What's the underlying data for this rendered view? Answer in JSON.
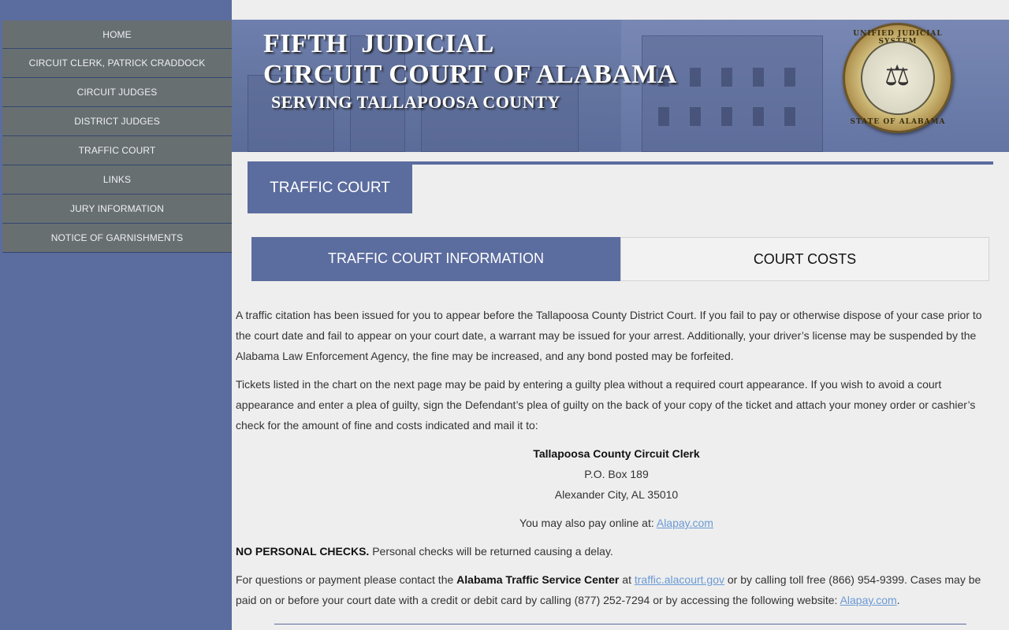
{
  "sidebar": {
    "items": [
      {
        "label": "HOME"
      },
      {
        "label": "CIRCUIT CLERK, PATRICK CRADDOCK"
      },
      {
        "label": "CIRCUIT JUDGES"
      },
      {
        "label": "DISTRICT JUDGES"
      },
      {
        "label": "TRAFFIC COURT"
      },
      {
        "label": "LINKS"
      },
      {
        "label": "JURY INFORMATION"
      },
      {
        "label": "NOTICE OF GARNISHMENTS"
      }
    ]
  },
  "banner": {
    "line1": "FIFTH  JUDICIAL",
    "line2": "CIRCUIT COURT OF ALABAMA",
    "line3": "SERVING TALLAPOOSA COUNTY",
    "seal_top": "UNIFIED JUDICIAL SYSTEM",
    "seal_bottom": "STATE OF ALABAMA",
    "seal_icon": "scales-of-justice-icon"
  },
  "section": {
    "title": "TRAFFIC COURT"
  },
  "tabs": [
    {
      "label": "TRAFFIC COURT INFORMATION",
      "active": true
    },
    {
      "label": "COURT COSTS",
      "active": false
    }
  ],
  "content": {
    "para1": "A traffic citation has been issued for you to appear before the Tallapoosa County District Court. If you fail to pay or otherwise dispose of your case prior to the court date and fail to appear on your court date, a warrant may be issued for your arrest. Additionally, your driver’s license may be suspended by the Alabama Law Enforcement Agency, the fine may be increased, and any bond posted may be forfeited.",
    "para2": "Tickets listed in the chart on the next page may be paid by entering a guilty plea without a required court appearance. If you wish to avoid a court appearance and enter a plea of guilty, sign the Defendant’s plea of guilty on the back of your copy of the ticket and attach your money order or cashier’s check for the amount of fine and costs indicated and mail it to:",
    "address_name": "Tallapoosa County Circuit Clerk",
    "address_box": "P.O. Box 189",
    "address_city": "Alexander City, AL 35010",
    "pay_online_prefix": "You may also pay online at: ",
    "pay_online_link": "Alapay.com",
    "no_checks_bold": "NO PERSONAL CHECKS.",
    "no_checks_text": " Personal checks will be returned causing a delay.",
    "questions_prefix": "For questions or payment please contact the ",
    "questions_bold": "Alabama Traffic Service Center",
    "questions_at": " at ",
    "questions_link": "traffic.alacourt.gov",
    "questions_mid": " or by calling toll free (866) 954-9399. Cases may be paid on or before your court date with a credit or debit card by calling (877) 252-7294 or by accessing the following website: ",
    "questions_link2": "Alapay.com",
    "questions_end": "."
  }
}
